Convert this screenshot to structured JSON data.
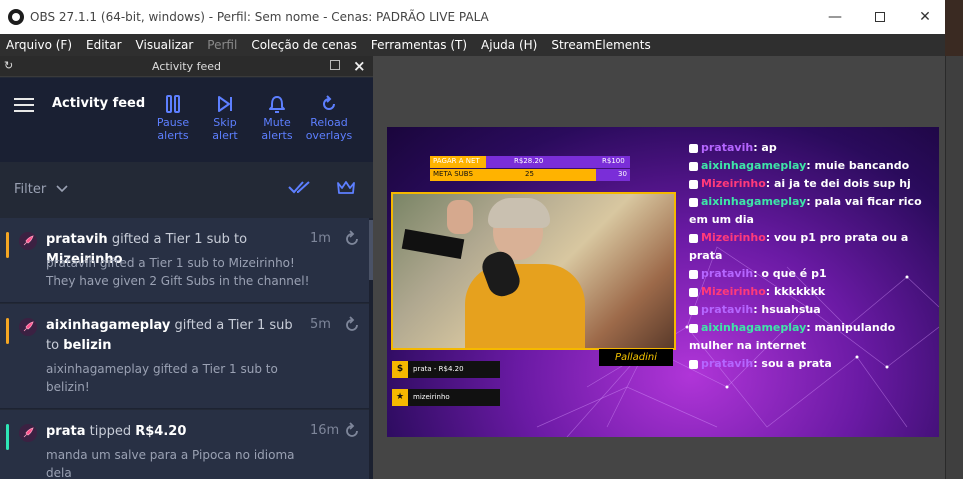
{
  "window": {
    "title": "OBS 27.1.1 (64-bit, windows) - Perfil: Sem nome - Cenas: PADRÃO LIVE PALA",
    "minimize": "—",
    "close": "✕"
  },
  "menu": [
    "Arquivo (F)",
    "Editar",
    "Visualizar",
    "Perfil",
    "Coleção de cenas",
    "Ferramentas (T)",
    "Ajuda (H)",
    "StreamElements"
  ],
  "dock": {
    "title": "Activity feed",
    "header_title": "Activity feed",
    "controls": [
      {
        "line1": "Pause",
        "line2": "alerts",
        "icon": "pause-icon"
      },
      {
        "line1": "Skip",
        "line2": "alert",
        "icon": "skip-icon"
      },
      {
        "line1": "Mute",
        "line2": "alerts",
        "icon": "bell-icon"
      },
      {
        "line1": "Reload",
        "line2": "overlays",
        "icon": "reload-icon"
      }
    ],
    "filter_label": "Filter",
    "accent": "#5d7fff",
    "feed": [
      {
        "user": "pratavih",
        "action": "gifted a Tier 1 sub to",
        "target": "Mizeirinho",
        "time": "1m",
        "body": [
          "pratavih gifted a Tier 1 sub to Mizeirinho!",
          "They have given 2 Gift Subs in the channel!"
        ],
        "bar_color": "#f5a623"
      },
      {
        "user": "aixinhagameplay",
        "action": "gifted a Tier 1 sub to",
        "target": "belizin",
        "time": "5m",
        "body": [
          "aixinhagameplay gifted a Tier 1 sub to",
          "belizin!"
        ],
        "bar_color": "#f5a623"
      },
      {
        "user": "prata",
        "action": "tipped",
        "target": "R$4.20",
        "time": "16m",
        "body": [
          "manda um salve para a Pipoca no idioma",
          "dela"
        ],
        "bar_color": "#2ee6b6"
      }
    ]
  },
  "scene": {
    "goals": [
      {
        "label": "PAGAR A NET",
        "value": "R$28.20",
        "max": "R$100",
        "progress": 0.28
      },
      {
        "label": "META SUBS",
        "value": "25",
        "max": "30",
        "progress": 0.83
      }
    ],
    "signature": "Palladini",
    "labels": [
      {
        "tag": "$",
        "text": "prata - R$4.20"
      },
      {
        "tag": "★",
        "text": "mizeirinho"
      }
    ],
    "chat": [
      {
        "user": "pratavih",
        "cls": "u-purple",
        "msg": "ap"
      },
      {
        "user": "aixinhagameplay",
        "cls": "u-green",
        "msg": "muie bancando"
      },
      {
        "user": "Mizeirinho",
        "cls": "u-pink",
        "msg": "ai ja te dei dois sup hj"
      },
      {
        "user": "aixinhagameplay",
        "cls": "u-green",
        "msg": "pala vai ficar rico em um dia"
      },
      {
        "user": "Mizeirinho",
        "cls": "u-pink",
        "msg": "vou p1 pro prata ou a prata"
      },
      {
        "user": "pratavih",
        "cls": "u-purple",
        "msg": "o que é p1"
      },
      {
        "user": "Mizeirinho",
        "cls": "u-pink",
        "msg": "kkkkkkk"
      },
      {
        "user": "pratavih",
        "cls": "u-purple",
        "msg": "hsuahsua"
      },
      {
        "user": "aixinhagameplay",
        "cls": "u-green",
        "msg": "manipulando mulher na internet"
      },
      {
        "user": "pratavih",
        "cls": "u-purple",
        "msg": "sou a prata"
      }
    ]
  }
}
